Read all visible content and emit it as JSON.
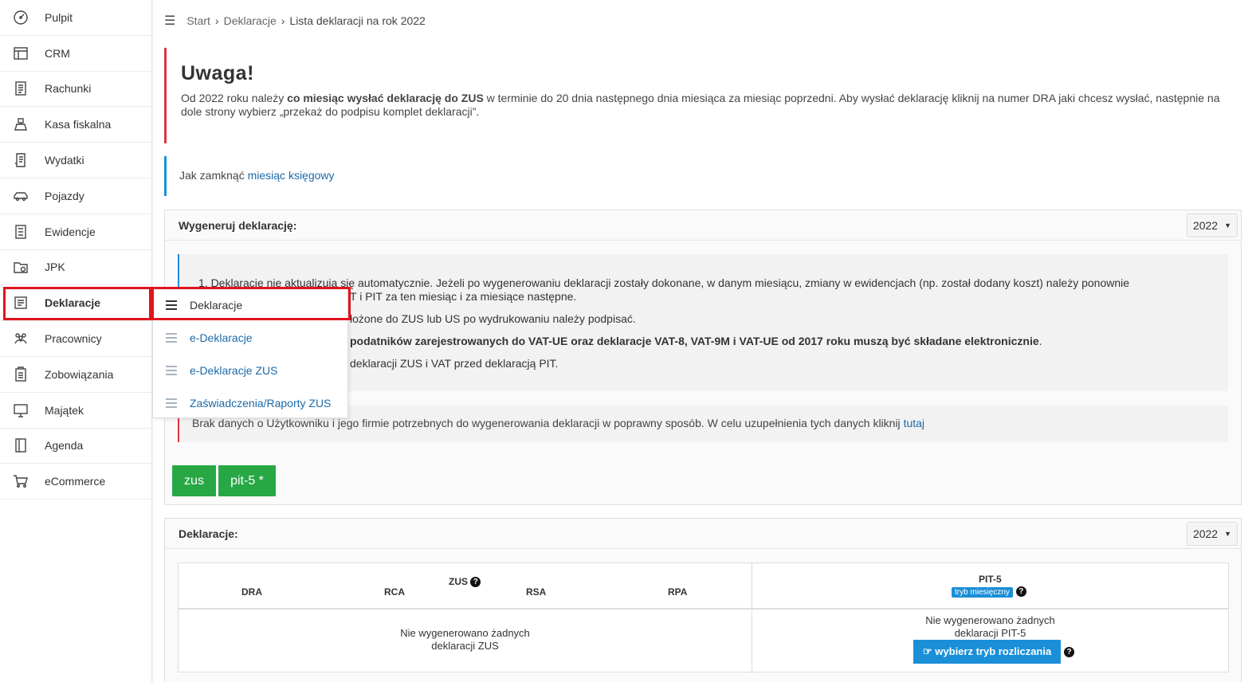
{
  "sidebar": {
    "items": [
      {
        "label": "Pulpit",
        "icon": "dashboard-icon"
      },
      {
        "label": "CRM",
        "icon": "crm-icon"
      },
      {
        "label": "Rachunki",
        "icon": "invoice-icon"
      },
      {
        "label": "Kasa fiskalna",
        "icon": "cash-register-icon"
      },
      {
        "label": "Wydatki",
        "icon": "receipt-icon"
      },
      {
        "label": "Pojazdy",
        "icon": "car-icon"
      },
      {
        "label": "Ewidencje",
        "icon": "records-icon"
      },
      {
        "label": "JPK",
        "icon": "folder-icon"
      },
      {
        "label": "Deklaracje",
        "icon": "declarations-icon"
      },
      {
        "label": "Pracownicy",
        "icon": "people-icon"
      },
      {
        "label": "Zobowiązania",
        "icon": "liabilities-icon"
      },
      {
        "label": "Majątek",
        "icon": "monitor-icon"
      },
      {
        "label": "Agenda",
        "icon": "agenda-icon"
      },
      {
        "label": "eCommerce",
        "icon": "cart-icon"
      }
    ]
  },
  "breadcrumb": {
    "items": [
      "Start",
      "Deklaracje",
      "Lista deklaracji na rok 2022"
    ]
  },
  "alert_warning": {
    "title": "Uwaga!",
    "text_a": "Od 2022 roku należy ",
    "text_bold": "co miesiąc wysłać deklarację do ZUS",
    "text_b": " w terminie do 20 dnia następnego dnia miesiąca za miesiąc poprzedni. Aby wysłać deklarację kliknij na numer DRA jaki chcesz wysłać, następnie na dole strony wybierz „przekaż do podpisu komplet deklaracji”."
  },
  "alert_info": {
    "text": "Jak zamknąć ",
    "link": "miesiąc księgowy"
  },
  "generate_panel": {
    "title": "Wygeneruj deklarację:",
    "year": "2022",
    "notes": {
      "n1a": "1. Deklaracje nie aktualizują się automatycznie. Jeżeli po wygenerowaniu deklaracji zostały dokonane, w danym miesiącu, zmiany w ewidencjach (np. został dodany koszt) należy ponownie",
      "n1b": "T i PIT za ten miesiąc i za miesiące następne.",
      "n2": "łożone do ZUS lub US po wydrukowaniu należy podpisać.",
      "n3_bold": "podatników zarejestrowanych do VAT-UE oraz deklaracje VAT-8, VAT-9M i VAT-UE od 2017 roku muszą być składane elektronicznie",
      "n3_tail": ".",
      "n4": "deklaracji ZUS i VAT przed deklaracją PIT."
    },
    "warning_text": "Brak danych o Użytkowniku i jego firmie potrzebnych do wygenerowania deklaracji w poprawny sposób. W celu uzupełnienia tych danych kliknij ",
    "warning_link": "tutaj",
    "buttons": [
      "zus",
      "pit-5 *"
    ]
  },
  "declarations_panel": {
    "title": "Deklaracje:",
    "year": "2022",
    "zus_header": "ZUS",
    "zus_columns": [
      "DRA",
      "RCA",
      "RSA",
      "RPA"
    ],
    "pit_header": "PIT-5",
    "pit_badge": "tryb miesięczny",
    "zus_empty_1": "Nie wygenerowano żadnych",
    "zus_empty_2": "deklaracji ZUS",
    "pit_empty_1": "Nie wygenerowano żadnych",
    "pit_empty_2": "deklaracji PIT-5",
    "pit_button": "wybierz tryb rozliczania"
  },
  "submenu": {
    "items": [
      "Deklaracje",
      "e-Deklaracje",
      "e-Deklaracje ZUS",
      "Zaświadczenia/Raporty ZUS"
    ]
  },
  "colors": {
    "accent_green": "#28a745",
    "accent_blue": "#1a8fd8",
    "alert_red": "#d9363e",
    "highlight_red": "#e0141e"
  }
}
